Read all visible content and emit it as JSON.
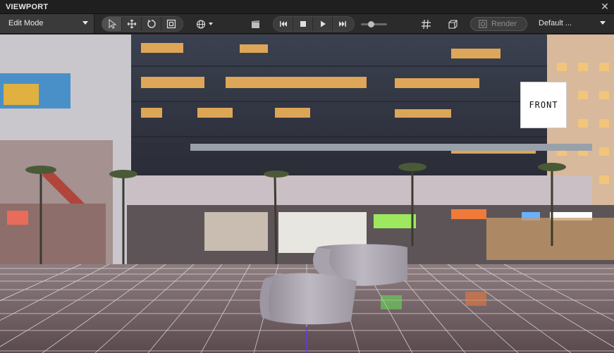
{
  "window": {
    "title": "VIEWPORT"
  },
  "toolbar": {
    "mode": "Edit Mode",
    "render_label": "Render",
    "preset": "Default ..."
  },
  "viewport": {
    "cube_face": "FRONT"
  },
  "icons": {
    "close": "close-icon",
    "select": "cursor-icon",
    "move": "move-icon",
    "rotate": "rotate-icon",
    "scale": "scale-icon",
    "globe": "globe-icon",
    "camera": "clapperboard-icon",
    "skip_back": "skip-back-icon",
    "stop": "stop-icon",
    "play": "play-icon",
    "skip_forward": "skip-forward-icon",
    "grid": "grid-icon",
    "box": "box-icon",
    "render": "render-icon"
  },
  "colors": {
    "titlebar": "#1f1f1f",
    "toolbar": "#2b2b2b",
    "text": "#e8e8e8"
  }
}
